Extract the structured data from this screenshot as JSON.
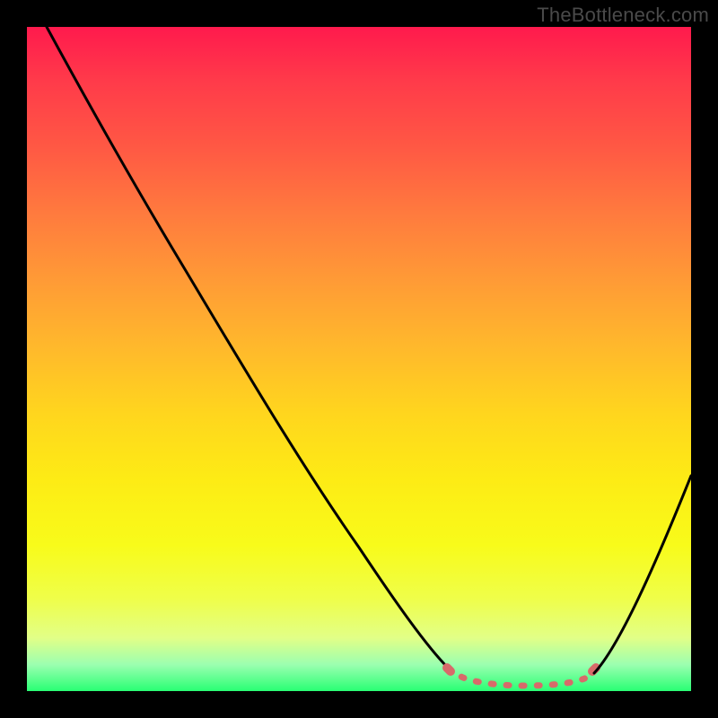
{
  "watermark": "TheBottleneck.com",
  "colors": {
    "frame": "#000000",
    "curve": "#000000",
    "dash": "#d86a6a",
    "gradient_top": "#ff1a4d",
    "gradient_bottom": "#29ff74"
  },
  "chart_data": {
    "type": "line",
    "title": "",
    "xlabel": "",
    "ylabel": "",
    "xlim": [
      0,
      100
    ],
    "ylim": [
      0,
      100
    ],
    "note": "Values estimated from pixel gridlines; y=0 at bottom (green), y=100 at top (red). Curve shows bottleneck-percentage-style V shape with flat near-zero trough around x≈68–82 (dashed in salmon), rising toward both ends.",
    "series": [
      {
        "name": "curve",
        "x": [
          3,
          10,
          20,
          30,
          40,
          50,
          58,
          62,
          65,
          68,
          72,
          76,
          80,
          83,
          86,
          90,
          95,
          100
        ],
        "values": [
          100,
          88,
          71,
          55,
          39,
          23,
          11,
          6,
          3.5,
          2,
          1.4,
          1.2,
          1.4,
          2,
          4,
          10,
          20,
          33
        ]
      }
    ],
    "dash_segment": {
      "x_start": 62,
      "x_end": 84
    }
  }
}
